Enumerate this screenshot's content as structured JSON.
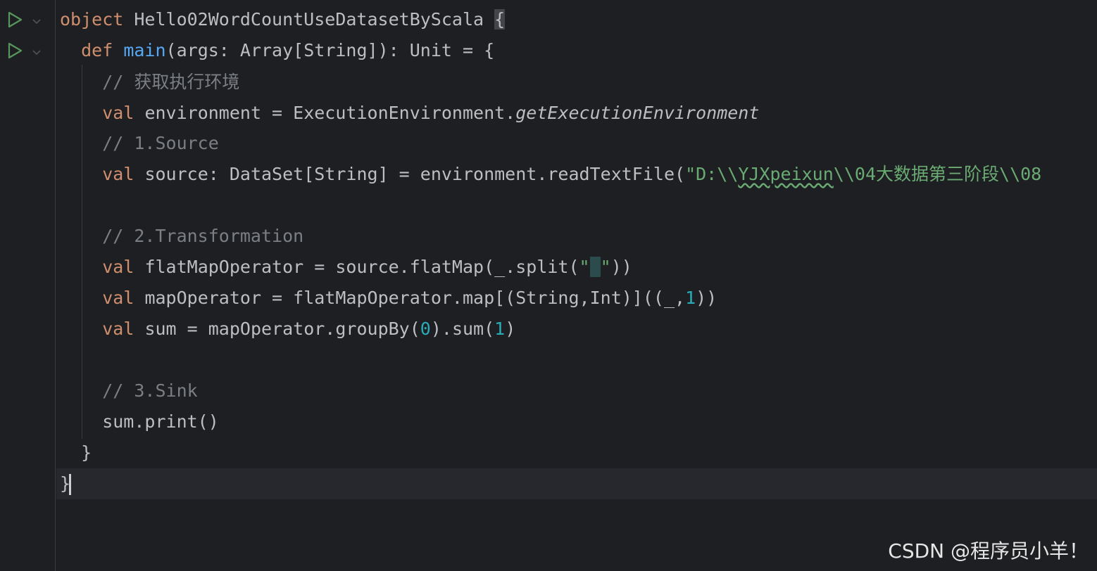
{
  "lines": [
    {
      "tokens": [
        [
          "kw",
          "object "
        ],
        [
          "",
          "Hello02WordCountUseDatasetByScala "
        ],
        [
          "brace",
          "{"
        ]
      ]
    },
    {
      "tokens": [
        [
          "",
          "  "
        ],
        [
          "kw",
          "def "
        ],
        [
          "fn",
          "main"
        ],
        [
          "",
          "(args: Array[String]): Unit = {"
        ]
      ]
    },
    {
      "tokens": [
        [
          "",
          "    "
        ],
        [
          "cm",
          "// "
        ],
        [
          "cm-cjk",
          "获取执行环境"
        ]
      ]
    },
    {
      "tokens": [
        [
          "",
          "    "
        ],
        [
          "kw",
          "val "
        ],
        [
          "",
          "environment = ExecutionEnvironment."
        ],
        [
          "it",
          "getExecutionEnvironment"
        ]
      ]
    },
    {
      "tokens": [
        [
          "",
          "    "
        ],
        [
          "cm",
          "// 1.Source"
        ]
      ]
    },
    {
      "tokens": [
        [
          "",
          "    "
        ],
        [
          "kw",
          "val "
        ],
        [
          "",
          "source: DataSet[String] = environment.readTextFile("
        ],
        [
          "str",
          "\"D:\\\\"
        ],
        [
          "str-typo",
          "YJXpeixun"
        ],
        [
          "str",
          "\\\\04"
        ],
        [
          "str-cjk",
          "大数据第三阶段"
        ],
        [
          "str",
          "\\\\08"
        ]
      ]
    },
    {
      "tokens": []
    },
    {
      "tokens": [
        [
          "",
          "    "
        ],
        [
          "cm",
          "// 2.Transformation"
        ]
      ]
    },
    {
      "tokens": [
        [
          "",
          "    "
        ],
        [
          "kw",
          "val "
        ],
        [
          "",
          "flatMapOperator = source.flatMap(_.split("
        ],
        [
          "str",
          "\""
        ],
        [
          "sp",
          " "
        ],
        [
          "str",
          "\""
        ],
        [
          "",
          "))"
        ]
      ]
    },
    {
      "tokens": [
        [
          "",
          "    "
        ],
        [
          "kw",
          "val "
        ],
        [
          "",
          "mapOperator = flatMapOperator.map[(String,Int)]((_,"
        ],
        [
          "num",
          "1"
        ],
        [
          "",
          "))"
        ]
      ]
    },
    {
      "tokens": [
        [
          "",
          "    "
        ],
        [
          "kw",
          "val "
        ],
        [
          "",
          "sum = mapOperator.groupBy("
        ],
        [
          "num",
          "0"
        ],
        [
          "",
          ").sum("
        ],
        [
          "num",
          "1"
        ],
        [
          "",
          ")"
        ]
      ]
    },
    {
      "tokens": []
    },
    {
      "tokens": [
        [
          "",
          "    "
        ],
        [
          "cm",
          "// 3.Sink"
        ]
      ]
    },
    {
      "tokens": [
        [
          "",
          "    sum.print()"
        ]
      ]
    },
    {
      "tokens": [
        [
          "",
          "  }"
        ]
      ]
    },
    {
      "tokens": [
        [
          "",
          "}"
        ],
        [
          "caret",
          ""
        ]
      ],
      "current": true
    }
  ],
  "gutter": {
    "run_lines": [
      0,
      1
    ],
    "run_icon": "run-play-icon",
    "fold_icon": "fold-chevron-icon"
  },
  "watermark": "CSDN @程序员小羊！",
  "colors": {
    "background": "#1e1f22",
    "keyword": "#cf8e6d",
    "function": "#56a8f5",
    "comment": "#7a7e85",
    "string": "#6aab73",
    "number": "#2aacb8",
    "text": "#bcbec4"
  }
}
